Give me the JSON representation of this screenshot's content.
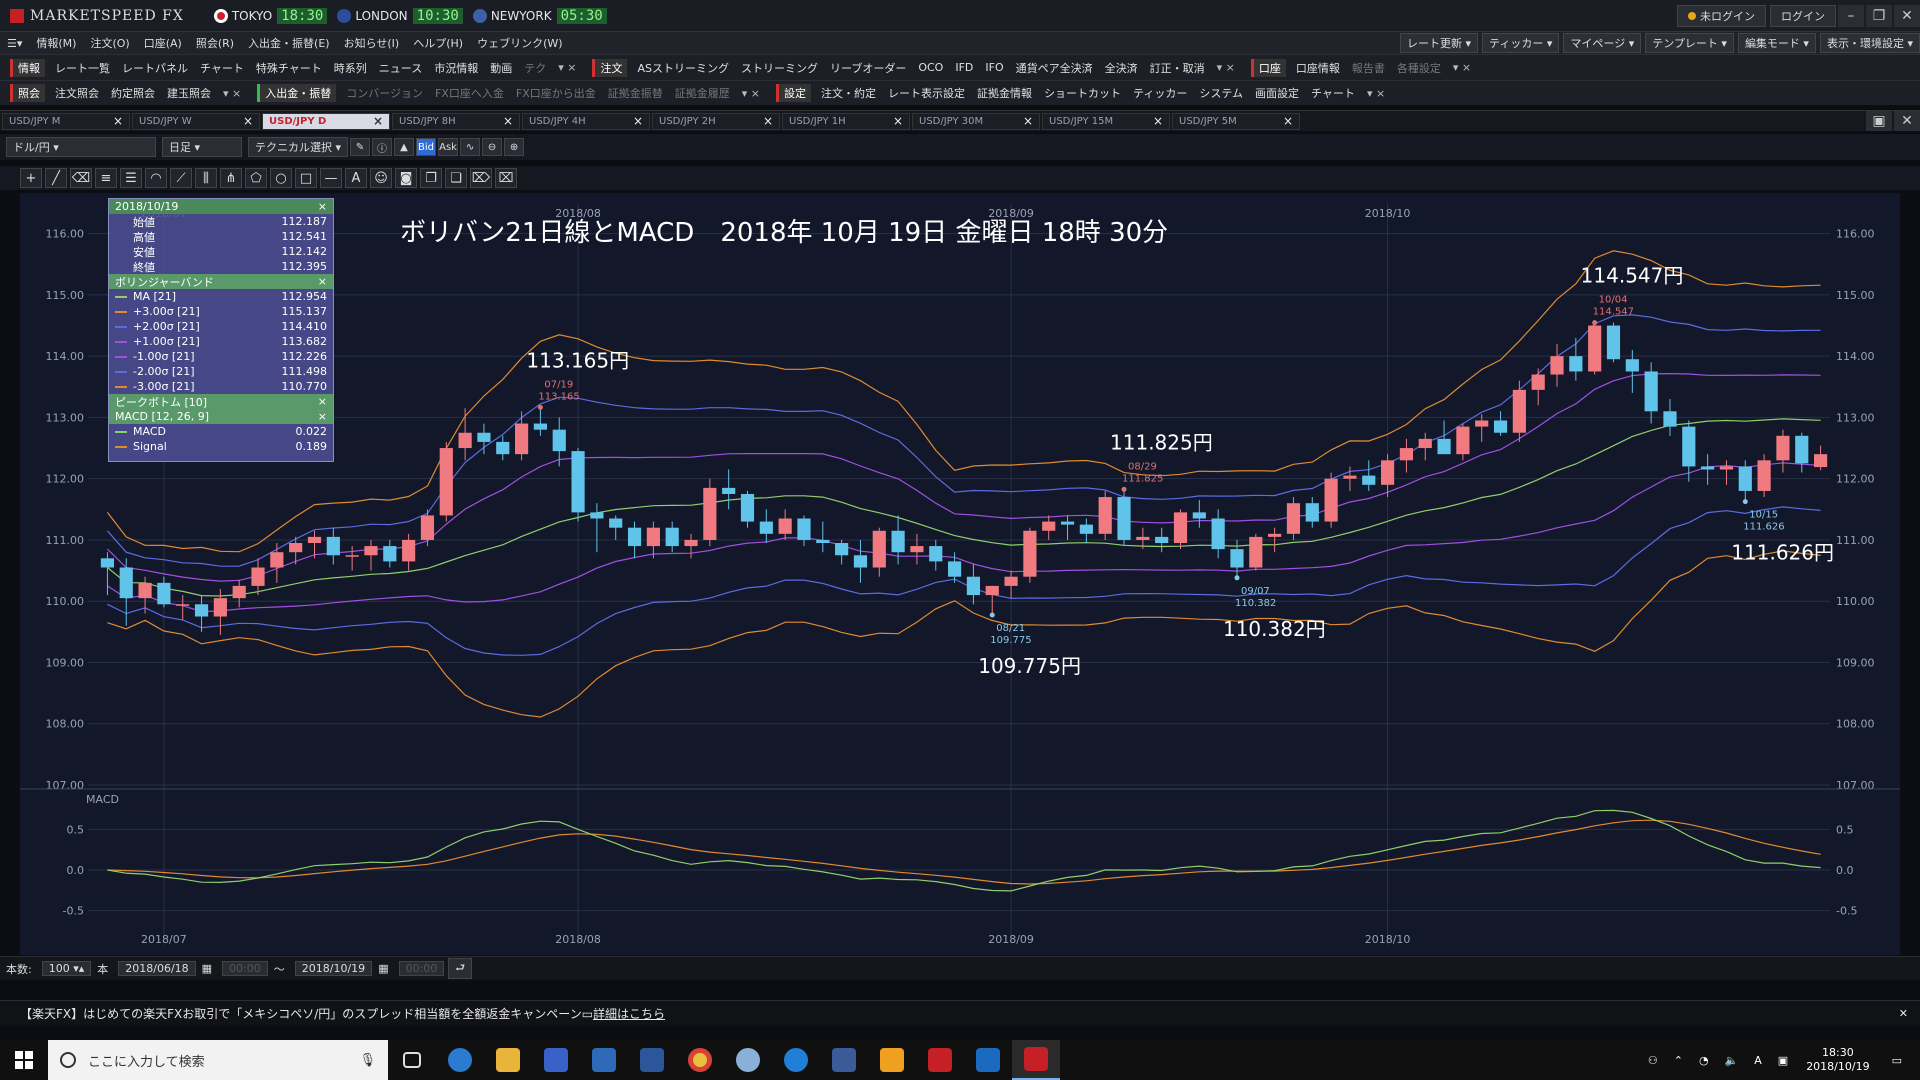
{
  "app": {
    "title": "MARKETSPEED FX",
    "cities": [
      {
        "name": "TOKYO",
        "time": "18:30",
        "flag_color": "#ffffff"
      },
      {
        "name": "LONDON",
        "time": "10:30",
        "flag_color": "#2b4d9a"
      },
      {
        "name": "NEWYORK",
        "time": "05:30",
        "flag_color": "#3c5fa8"
      }
    ],
    "login_status": "未ログイン",
    "login_button": "ログイン"
  },
  "menubar": {
    "items": [
      "情報(M)",
      "注文(O)",
      "口座(A)",
      "照会(R)",
      "入出金・振替(E)",
      "お知らせ(I)",
      "ヘルプ(H)",
      "ウェブリンク(W)"
    ],
    "right": [
      "レート更新",
      "ティッカー",
      "マイページ",
      "テンプレート",
      "編集モード",
      "表示・環境設定"
    ]
  },
  "toolbar1": {
    "section1": "情報",
    "items1": [
      "レート一覧",
      "レートパネル",
      "チャート",
      "特殊チャート",
      "時系列",
      "ニュース",
      "市況情報",
      "動画",
      "テク"
    ],
    "section2": "注文",
    "items2": [
      "ASストリーミング",
      "ストリーミング",
      "リーブオーダー",
      "OCO",
      "IFD",
      "IFO",
      "通貨ペア全決済",
      "全決済",
      "訂正・取消"
    ],
    "section3": "口座",
    "items3": [
      "口座情報",
      "報告書",
      "各種設定"
    ]
  },
  "toolbar2": {
    "section1": "照会",
    "items1": [
      "注文照会",
      "約定照会",
      "建玉照会"
    ],
    "section2": "入出金・振替",
    "items2": [
      "コンバージョン",
      "FX口座へ入金",
      "FX口座から出金",
      "証拠金振替",
      "証拠金履歴"
    ],
    "section3": "設定",
    "items3": [
      "注文・約定",
      "レート表示設定",
      "証拠金情報",
      "ショートカット",
      "ティッカー",
      "システム",
      "画面設定",
      "チャート"
    ]
  },
  "tabs": [
    {
      "label": "USD/JPY M",
      "active": false
    },
    {
      "label": "USD/JPY W",
      "active": false
    },
    {
      "label": "USD/JPY D",
      "active": true
    },
    {
      "label": "USD/JPY 8H",
      "active": false
    },
    {
      "label": "USD/JPY 4H",
      "active": false
    },
    {
      "label": "USD/JPY 2H",
      "active": false
    },
    {
      "label": "USD/JPY 1H",
      "active": false
    },
    {
      "label": "USD/JPY 30M",
      "active": false
    },
    {
      "label": "USD/JPY 15M",
      "active": false
    },
    {
      "label": "USD/JPY 5M",
      "active": false
    }
  ],
  "chart_tools": {
    "pair": "ドル/円",
    "period": "日足",
    "technical": "テクニカル選択",
    "bid": "Bid",
    "ask": "Ask"
  },
  "info_panel": {
    "date": "2018/10/19",
    "ohlc": [
      {
        "label": "始値",
        "value": "112.187"
      },
      {
        "label": "高値",
        "value": "112.541"
      },
      {
        "label": "安値",
        "value": "112.142"
      },
      {
        "label": "終値",
        "value": "112.395"
      }
    ],
    "bb_title": "ボリンジャーバンド",
    "bb": [
      {
        "label": "MA [21]",
        "value": "112.954",
        "color": "#8fcf6a"
      },
      {
        "label": "+3.00σ [21]",
        "value": "115.137",
        "color": "#e08a30"
      },
      {
        "label": "+2.00σ [21]",
        "value": "114.410",
        "color": "#5a6ce0"
      },
      {
        "label": "+1.00σ [21]",
        "value": "113.682",
        "color": "#a050e0"
      },
      {
        "label": "-1.00σ [21]",
        "value": "112.226",
        "color": "#a050e0"
      },
      {
        "label": "-2.00σ [21]",
        "value": "111.498",
        "color": "#5a6ce0"
      },
      {
        "label": "-3.00σ [21]",
        "value": "110.770",
        "color": "#e08a30"
      }
    ],
    "peak_title": "ピークボトム [10]",
    "macd_title": "MACD [12, 26, 9]",
    "macd": [
      {
        "label": "MACD",
        "value": "0.022",
        "color": "#8fcf6a"
      },
      {
        "label": "Signal",
        "value": "0.189",
        "color": "#e08a30"
      }
    ]
  },
  "chart_data": {
    "type": "candlestick",
    "title": "ボリバン21日線とMACD　2018年 10月 19日 金曜日 18時 30分",
    "x_labels": [
      "2018/07",
      "2018/08",
      "2018/09",
      "2018/10"
    ],
    "y_ticks": [
      "116.00",
      "115.00",
      "114.00",
      "113.00",
      "112.00",
      "111.00",
      "110.00",
      "109.00",
      "108.00",
      "107.00"
    ],
    "ylim": [
      107.0,
      116.5
    ],
    "macd_ticks": [
      "0.5",
      "0.0",
      "-0.5"
    ],
    "macd_label": "MACD",
    "candles": [
      [
        110.7,
        110.8,
        110.1,
        110.55
      ],
      [
        110.55,
        110.7,
        109.6,
        110.05
      ],
      [
        110.05,
        110.4,
        109.8,
        110.3
      ],
      [
        110.3,
        110.4,
        109.9,
        109.95
      ],
      [
        109.95,
        110.1,
        109.7,
        109.95
      ],
      [
        109.95,
        110.1,
        109.5,
        109.75
      ],
      [
        109.75,
        110.2,
        109.45,
        110.05
      ],
      [
        110.05,
        110.35,
        109.9,
        110.25
      ],
      [
        110.25,
        110.7,
        110.1,
        110.55
      ],
      [
        110.55,
        110.95,
        110.3,
        110.8
      ],
      [
        110.8,
        111.05,
        110.6,
        110.95
      ],
      [
        110.95,
        111.15,
        110.7,
        111.05
      ],
      [
        111.05,
        111.2,
        110.6,
        110.75
      ],
      [
        110.75,
        110.9,
        110.5,
        110.75
      ],
      [
        110.75,
        111.0,
        110.5,
        110.9
      ],
      [
        110.9,
        111.0,
        110.55,
        110.65
      ],
      [
        110.65,
        111.1,
        110.5,
        111.0
      ],
      [
        111.0,
        111.5,
        110.9,
        111.4
      ],
      [
        111.4,
        112.6,
        111.3,
        112.5
      ],
      [
        112.5,
        113.15,
        112.3,
        112.75
      ],
      [
        112.75,
        112.9,
        112.4,
        112.6
      ],
      [
        112.6,
        112.7,
        112.3,
        112.4
      ],
      [
        112.4,
        113.1,
        112.3,
        112.9
      ],
      [
        112.9,
        113.17,
        112.7,
        112.8
      ],
      [
        112.8,
        113.0,
        112.2,
        112.45
      ],
      [
        112.45,
        112.5,
        111.3,
        111.45
      ],
      [
        111.45,
        111.6,
        110.8,
        111.35
      ],
      [
        111.35,
        111.4,
        111.0,
        111.2
      ],
      [
        111.2,
        111.3,
        110.7,
        110.9
      ],
      [
        110.9,
        111.3,
        110.7,
        111.2
      ],
      [
        111.2,
        111.3,
        110.8,
        110.9
      ],
      [
        110.9,
        111.1,
        110.7,
        111.0
      ],
      [
        111.0,
        112.0,
        110.9,
        111.85
      ],
      [
        111.85,
        112.15,
        111.5,
        111.75
      ],
      [
        111.75,
        111.8,
        111.2,
        111.3
      ],
      [
        111.3,
        111.5,
        110.95,
        111.1
      ],
      [
        111.1,
        111.5,
        111.0,
        111.35
      ],
      [
        111.35,
        111.4,
        110.9,
        111.0
      ],
      [
        111.0,
        111.3,
        110.8,
        110.95
      ],
      [
        110.95,
        111.0,
        110.6,
        110.75
      ],
      [
        110.75,
        111.0,
        110.3,
        110.55
      ],
      [
        110.55,
        111.2,
        110.4,
        111.15
      ],
      [
        111.15,
        111.4,
        110.6,
        110.8
      ],
      [
        110.8,
        111.1,
        110.6,
        110.9
      ],
      [
        110.9,
        111.0,
        110.5,
        110.65
      ],
      [
        110.65,
        110.8,
        110.3,
        110.4
      ],
      [
        110.4,
        110.6,
        109.95,
        110.1
      ],
      [
        110.1,
        110.25,
        109.78,
        110.25
      ],
      [
        110.25,
        110.5,
        110.05,
        110.4
      ],
      [
        110.4,
        111.2,
        110.3,
        111.15
      ],
      [
        111.15,
        111.4,
        111.0,
        111.3
      ],
      [
        111.3,
        111.4,
        111.0,
        111.25
      ],
      [
        111.25,
        111.35,
        110.95,
        111.1
      ],
      [
        111.1,
        111.8,
        111.0,
        111.7
      ],
      [
        111.7,
        111.83,
        110.9,
        111.0
      ],
      [
        111.0,
        111.2,
        110.85,
        111.05
      ],
      [
        111.05,
        111.2,
        110.8,
        110.95
      ],
      [
        110.95,
        111.5,
        110.85,
        111.45
      ],
      [
        111.45,
        111.65,
        111.2,
        111.35
      ],
      [
        111.35,
        111.5,
        110.7,
        110.85
      ],
      [
        110.85,
        111.0,
        110.38,
        110.55
      ],
      [
        110.55,
        111.1,
        110.5,
        111.05
      ],
      [
        111.05,
        111.2,
        110.8,
        111.1
      ],
      [
        111.1,
        111.7,
        111.0,
        111.6
      ],
      [
        111.6,
        111.7,
        111.2,
        111.3
      ],
      [
        111.3,
        112.1,
        111.2,
        112.0
      ],
      [
        112.0,
        112.2,
        111.8,
        112.05
      ],
      [
        112.05,
        112.3,
        111.8,
        111.9
      ],
      [
        111.9,
        112.4,
        111.7,
        112.3
      ],
      [
        112.3,
        112.65,
        112.1,
        112.5
      ],
      [
        112.5,
        112.75,
        112.3,
        112.65
      ],
      [
        112.65,
        112.95,
        112.4,
        112.4
      ],
      [
        112.4,
        112.9,
        112.3,
        112.85
      ],
      [
        112.85,
        113.05,
        112.6,
        112.95
      ],
      [
        112.95,
        113.1,
        112.7,
        112.75
      ],
      [
        112.75,
        113.6,
        112.6,
        113.45
      ],
      [
        113.45,
        113.8,
        113.2,
        113.7
      ],
      [
        113.7,
        114.2,
        113.5,
        114.0
      ],
      [
        114.0,
        114.3,
        113.6,
        113.75
      ],
      [
        113.75,
        114.55,
        113.7,
        114.5
      ],
      [
        114.5,
        114.55,
        113.9,
        113.95
      ],
      [
        113.95,
        114.1,
        113.4,
        113.75
      ],
      [
        113.75,
        113.9,
        112.9,
        113.1
      ],
      [
        113.1,
        113.3,
        112.7,
        112.85
      ],
      [
        112.85,
        112.95,
        111.95,
        112.2
      ],
      [
        112.2,
        112.4,
        111.9,
        112.15
      ],
      [
        112.15,
        112.3,
        111.9,
        112.2
      ],
      [
        112.2,
        112.3,
        111.63,
        111.8
      ],
      [
        111.8,
        112.4,
        111.7,
        112.3
      ],
      [
        112.3,
        112.8,
        112.1,
        112.7
      ],
      [
        112.7,
        112.75,
        112.1,
        112.25
      ],
      [
        112.19,
        112.54,
        112.14,
        112.4
      ]
    ],
    "annotations": [
      {
        "text": "113.165円",
        "idx": 23,
        "price": 113.165,
        "kind": "high",
        "date": "07/19",
        "val": "113.165"
      },
      {
        "text": "109.775円",
        "idx": 47,
        "price": 109.775,
        "kind": "low",
        "date": "08/21",
        "val": "109.775"
      },
      {
        "text": "111.825円",
        "idx": 54,
        "price": 111.825,
        "kind": "high",
        "date": "08/29",
        "val": "111.825"
      },
      {
        "text": "110.382円",
        "idx": 60,
        "price": 110.382,
        "kind": "low",
        "date": "09/07",
        "val": "110.382"
      },
      {
        "text": "114.547円",
        "idx": 79,
        "price": 114.547,
        "kind": "high",
        "date": "10/04",
        "val": "114.547"
      },
      {
        "text": "111.626円",
        "idx": 87,
        "price": 111.626,
        "kind": "low",
        "date": "10/15",
        "val": "111.626"
      }
    ],
    "colors": {
      "up": "#f07a80",
      "down": "#5fc3ea",
      "ma": "#8fcf6a",
      "s1": "#a050e0",
      "s2": "#5a6ce0",
      "s3": "#e08a30",
      "macd": "#8fcf6a",
      "signal": "#e08a30",
      "high_lbl": "#e07070",
      "low_lbl": "#8ac8e8"
    }
  },
  "statusrow": {
    "count_label": "本数:",
    "count": "100",
    "unit": "本",
    "from": "2018/06/18",
    "from_time": "00:00",
    "tilde": "～",
    "to": "2018/10/19",
    "to_time": "00:00"
  },
  "news": {
    "text": "【楽天FX】はじめての楽天FXお取引で「メキシコペソ/円」のスプレッド相当額を全額返金キャンペーン",
    "link": "詳細はこちら"
  },
  "taskbar": {
    "search_placeholder": "ここに入力して検索",
    "time": "18:30",
    "date": "2018/10/19",
    "ime": "A"
  }
}
